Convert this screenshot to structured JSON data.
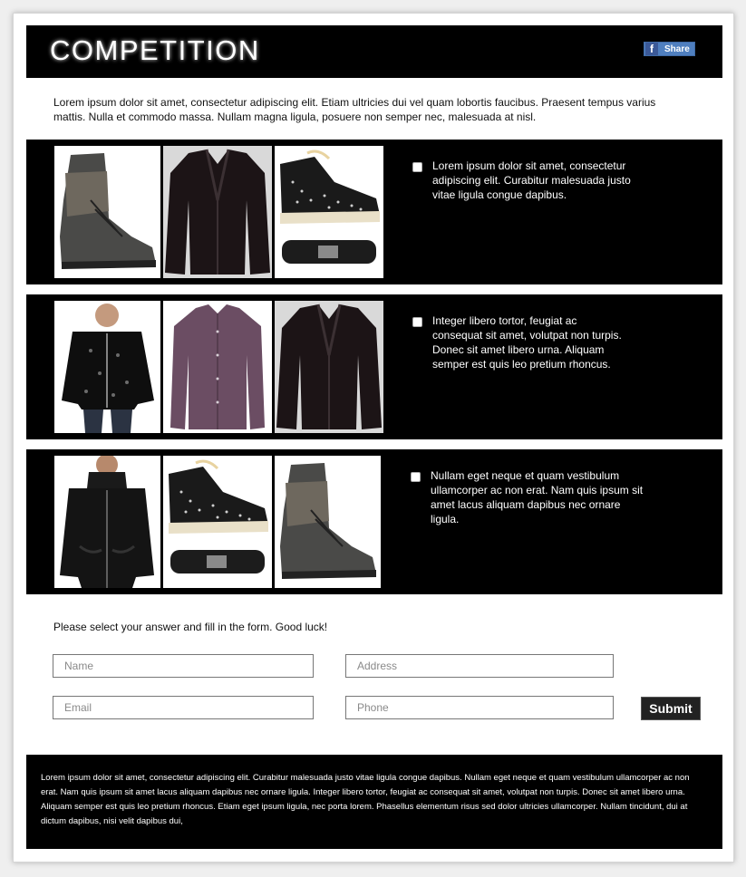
{
  "header": {
    "title": "COMPETITION",
    "share_label": "Share",
    "share_icon": "facebook-icon",
    "fb_glyph": "f"
  },
  "intro": "Lorem ipsum dolor sit amet, consectetur adipiscing elit. Etiam ultricies dui vel quam lobortis faucibus. Praesent tempus varius mattis. Nulla et commodo massa. Nullam magna ligula, posuere non semper nec, malesuada at nisl.",
  "options": [
    {
      "text": "Lorem ipsum dolor sit amet, consectetur adipiscing elit. Curabitur malesuada justo vitae ligula congue dapibus.",
      "checked": false,
      "images": [
        "boot",
        "leather-jacket",
        "studded-sneaker-and-belt"
      ]
    },
    {
      "text": "Integer libero tortor, feugiat ac consequat sit amet, volutpat non turpis. Donec sit amet libero urna. Aliquam semper est quis leo pretium rhoncus.",
      "checked": false,
      "images": [
        "sequin-jacket-model",
        "purple-shirt",
        "leather-jacket"
      ]
    },
    {
      "text": "Nullam eget neque et quam vestibulum ullamcorper ac non erat. Nam quis ipsum sit amet lacus aliquam dapibus nec ornare ligula.",
      "checked": false,
      "images": [
        "black-cardigan-model",
        "studded-sneaker-and-belt",
        "boot"
      ]
    }
  ],
  "form": {
    "instruction": "Please select your answer and fill in the form. Good luck!",
    "name_placeholder": "Name",
    "address_placeholder": "Address",
    "email_placeholder": "Email",
    "phone_placeholder": "Phone",
    "submit_label": "Submit"
  },
  "footer": {
    "text": "Lorem ipsum dolor sit amet, consectetur adipiscing elit. Curabitur malesuada justo vitae ligula congue dapibus. Nullam eget neque et quam vestibulum ullamcorper ac non erat. Nam quis ipsum sit amet lacus aliquam dapibus nec ornare ligula. Integer libero tortor, feugiat ac consequat sit amet, volutpat non turpis. Donec sit amet libero urna. Aliquam semper est quis leo pretium rhoncus. Etiam eget ipsum ligula, nec porta lorem. Phasellus elementum risus sed dolor ultricies ullamcorper. Nullam tincidunt, dui at dictum dapibus, nisi velit dapibus dui,"
  },
  "colors": {
    "band": "#000000",
    "share": "#4f7fbf",
    "submit": "#222222"
  }
}
